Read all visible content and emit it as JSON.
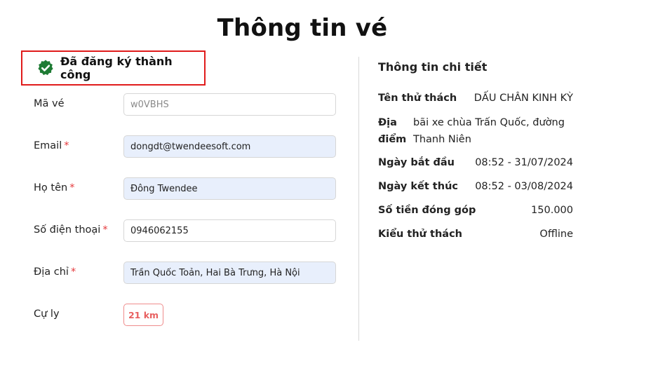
{
  "page": {
    "title": "Thông tin vé"
  },
  "status": {
    "text": "Đã đăng ký thành công",
    "icon": "verified-check-icon",
    "color": "#1e7b34"
  },
  "form": {
    "ticket_code": {
      "label": "Mã vé",
      "value": "w0VBHS",
      "required": false
    },
    "email": {
      "label": "Email",
      "value": "dongdt@twendeesoft.com",
      "required": true
    },
    "full_name": {
      "label": "Họ tên",
      "value": "Đông Twendee",
      "required": true
    },
    "phone": {
      "label": "Số điện thoại",
      "value": "0946062155",
      "required": true
    },
    "address": {
      "label": "Địa chỉ",
      "value": "Trần Quốc Toản, Hai Bà Trưng, Hà Nội",
      "required": true
    },
    "distance": {
      "label": "Cự ly",
      "value": "21 km"
    },
    "required_mark": "*"
  },
  "details": {
    "title": "Thông tin chi tiết",
    "challenge_name": {
      "label": "Tên thử thách",
      "value": "DẤU CHÂN KINH KỲ"
    },
    "location": {
      "label": "Địa điểm",
      "value": "bãi xe chùa Trấn Quốc, đường Thanh Niên"
    },
    "start_date": {
      "label": "Ngày bắt đầu",
      "value": "08:52 - 31/07/2024"
    },
    "end_date": {
      "label": "Ngày kết thúc",
      "value": "08:52 - 03/08/2024"
    },
    "contribution": {
      "label": "Số tiền đóng góp",
      "value": "150.000"
    },
    "challenge_type": {
      "label": "Kiểu thử thách",
      "value": "Offline"
    }
  },
  "colors": {
    "accent_red": "#e01b1b",
    "input_filled_bg": "#e8effc",
    "badge_red": "#e86060"
  }
}
